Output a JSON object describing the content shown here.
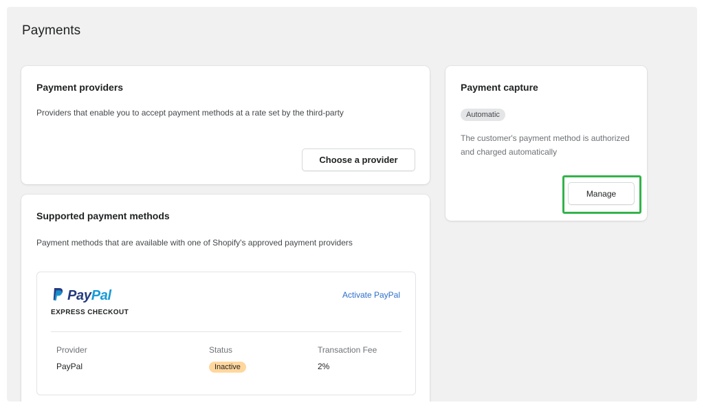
{
  "page": {
    "title": "Payments"
  },
  "providers_card": {
    "title": "Payment providers",
    "description": "Providers that enable you to accept payment methods at a rate set by the third-party",
    "button_label": "Choose a provider"
  },
  "capture_card": {
    "title": "Payment capture",
    "badge": "Automatic",
    "description": "The customer's payment method is authorized and charged automatically",
    "button_label": "Manage"
  },
  "supported_card": {
    "title": "Supported payment methods",
    "description": "Payment methods that are available with one of Shopify's approved payment providers",
    "paypal": {
      "logo_pay": "Pay",
      "logo_pal": "Pal",
      "subtitle": "EXPRESS CHECKOUT",
      "activate_label": "Activate PayPal",
      "columns": {
        "provider_label": "Provider",
        "provider_value": "PayPal",
        "status_label": "Status",
        "status_value": "Inactive",
        "fee_label": "Transaction Fee",
        "fee_value": "2%"
      }
    }
  },
  "colors": {
    "highlight": "#32b34a",
    "paypal_dark": "#253b80",
    "paypal_light": "#179bd7",
    "link": "#2c6ecb",
    "inactive_badge": "#ffd79d"
  },
  "icons": {
    "paypal": "paypal-logo-icon"
  }
}
